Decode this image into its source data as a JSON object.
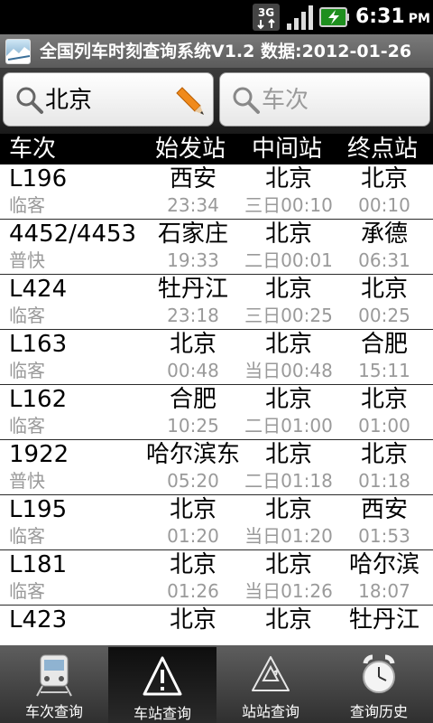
{
  "status_bar": {
    "network": "3G",
    "time": "6:31",
    "ampm": "PM",
    "icons": [
      "3g-icon",
      "signal-icon",
      "battery-charging-icon"
    ]
  },
  "app": {
    "title": "全国列车时刻查询系统V1.2 数据:2012-01-26"
  },
  "search": {
    "station_value": "北京",
    "train_placeholder": "车次"
  },
  "table": {
    "headers": [
      "车次",
      "始发站",
      "中间站",
      "终点站"
    ],
    "rows": [
      {
        "train": "L196",
        "type": "临客",
        "origin": "西安",
        "origin_time": "23:34",
        "mid": "北京",
        "mid_time": "三日00:10",
        "dest": "北京",
        "dest_time": "00:10"
      },
      {
        "train": "4452/4453",
        "type": "普快",
        "origin": "石家庄",
        "origin_time": "19:33",
        "mid": "北京",
        "mid_time": "二日00:01",
        "dest": "承德",
        "dest_time": "06:31"
      },
      {
        "train": "L424",
        "type": "临客",
        "origin": "牡丹江",
        "origin_time": "23:18",
        "mid": "北京",
        "mid_time": "三日00:25",
        "dest": "北京",
        "dest_time": "00:25"
      },
      {
        "train": "L163",
        "type": "临客",
        "origin": "北京",
        "origin_time": "00:48",
        "mid": "北京",
        "mid_time": "当日00:48",
        "dest": "合肥",
        "dest_time": "15:11"
      },
      {
        "train": "L162",
        "type": "临客",
        "origin": "合肥",
        "origin_time": "10:25",
        "mid": "北京",
        "mid_time": "二日01:00",
        "dest": "北京",
        "dest_time": "01:00"
      },
      {
        "train": "1922",
        "type": "普快",
        "origin": "哈尔滨东",
        "origin_time": "05:20",
        "mid": "北京",
        "mid_time": "二日01:18",
        "dest": "北京",
        "dest_time": "01:18"
      },
      {
        "train": "L195",
        "type": "临客",
        "origin": "北京",
        "origin_time": "01:20",
        "mid": "北京",
        "mid_time": "当日01:20",
        "dest": "西安",
        "dest_time": "01:53"
      },
      {
        "train": "L181",
        "type": "临客",
        "origin": "北京",
        "origin_time": "01:26",
        "mid": "北京",
        "mid_time": "当日01:26",
        "dest": "哈尔滨",
        "dest_time": "18:07"
      },
      {
        "train": "L423",
        "type": "",
        "origin": "北京",
        "origin_time": "",
        "mid": "北京",
        "mid_time": "",
        "dest": "牡丹江",
        "dest_time": ""
      }
    ]
  },
  "tabs": [
    {
      "label": "车次查询",
      "icon": "train-icon",
      "active": false
    },
    {
      "label": "车站查询",
      "icon": "warning-triangle-icon",
      "active": true
    },
    {
      "label": "站站查询",
      "icon": "recycle-triangle-icon",
      "active": false
    },
    {
      "label": "查询历史",
      "icon": "alarm-clock-icon",
      "active": false
    }
  ],
  "colors": {
    "header_bg": "#000000",
    "secondary_text": "#9a9a9a",
    "tab_active_bg": "#111111"
  }
}
